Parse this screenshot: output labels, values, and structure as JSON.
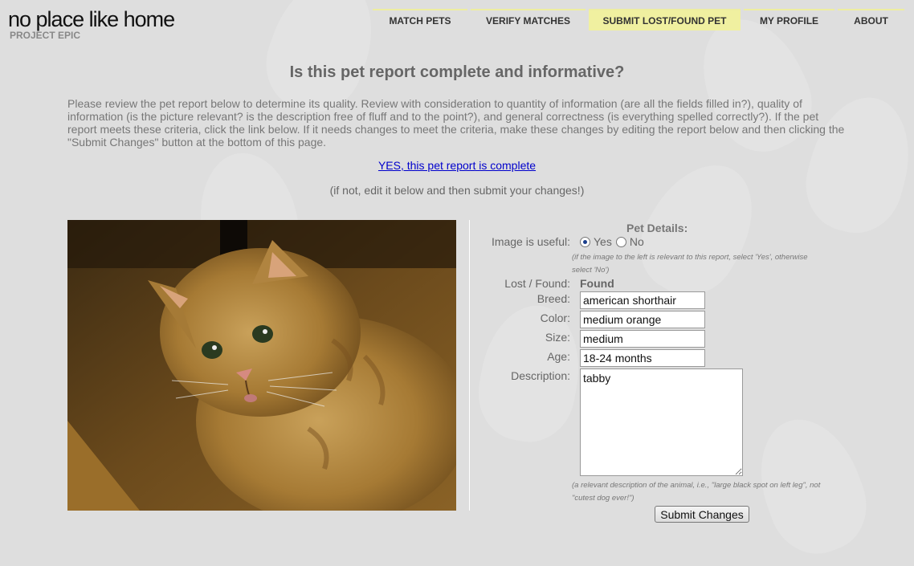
{
  "brand": {
    "title": "no place like home",
    "subtitle": "PROJECT EPIC"
  },
  "nav": {
    "items": [
      {
        "label": "MATCH PETS",
        "active": false
      },
      {
        "label": "VERIFY MATCHES",
        "active": false
      },
      {
        "label": "SUBMIT LOST/FOUND PET",
        "active": true
      },
      {
        "label": "MY PROFILE",
        "active": false
      },
      {
        "label": "ABOUT",
        "active": false
      }
    ]
  },
  "main": {
    "heading": "Is this pet report complete and informative?",
    "intro": "Please review the pet report below to determine its quality. Review with consideration to quantity of information (are all the fields filled in?), quality of information (is the picture relevant? is the description free of fluff and to the point?), and general correctness (is everything spelled correctly?). If the pet report meets these criteria, click the link below. If it needs changes to meet the criteria, make these changes by editing the report below and then clicking the \"Submit Changes\" button at the bottom of this page.",
    "yes_link": "YES, this pet report is complete",
    "if_not": "(if not, edit it below and then submit your changes!)"
  },
  "form": {
    "title": "Pet Details:",
    "image_useful_label": "Image is useful:",
    "yes_option": "Yes",
    "no_option": "No",
    "image_useful_value": "Yes",
    "image_hint": "(if the image to the left is relevant to this report, select 'Yes', otherwise select 'No')",
    "lost_found_label": "Lost / Found:",
    "lost_found_value": "Found",
    "breed_label": "Breed:",
    "breed_value": "american shorthair",
    "color_label": "Color:",
    "color_value": "medium orange",
    "size_label": "Size:",
    "size_value": "medium",
    "age_label": "Age:",
    "age_value": "18-24 months",
    "description_label": "Description:",
    "description_value": "tabby",
    "description_hint": "(a relevant description of the animal, i.e., \"large black spot on left leg\", not \"cutest dog ever!\")",
    "submit_label": "Submit Changes"
  },
  "colors": {
    "page_background": "#dedede",
    "active_nav": "#f0f0a0",
    "link": "#0000cc"
  }
}
